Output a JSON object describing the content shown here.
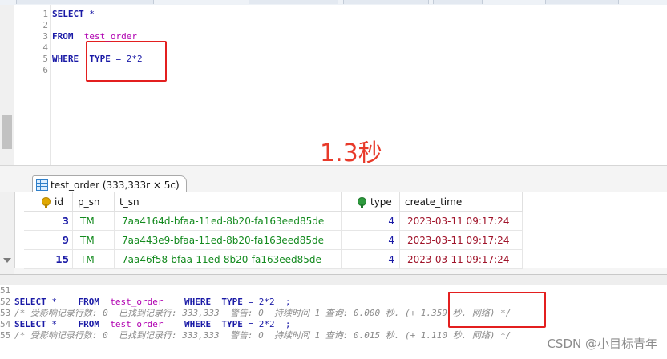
{
  "editor": {
    "lines": [
      {
        "n": "1",
        "parts": [
          [
            "kw",
            "SELECT"
          ],
          [
            "op",
            " *"
          ]
        ]
      },
      {
        "n": "2",
        "parts": []
      },
      {
        "n": "3",
        "parts": [
          [
            "kw",
            "FROM"
          ],
          [
            "op",
            "  "
          ],
          [
            "tbl",
            "test_order"
          ]
        ]
      },
      {
        "n": "4",
        "parts": []
      },
      {
        "n": "5",
        "parts": [
          [
            "kw",
            "WHERE"
          ],
          [
            "op",
            "  "
          ],
          [
            "kw",
            "TYPE"
          ],
          [
            "op",
            " = "
          ],
          [
            "num",
            "2*2"
          ]
        ]
      },
      {
        "n": "6",
        "parts": []
      }
    ],
    "timing_note": "1.3秒"
  },
  "result_tab": {
    "label": "test_order (333,333r × 5c)"
  },
  "grid": {
    "columns": [
      "id",
      "p_sn",
      "t_sn",
      "type",
      "create_time"
    ],
    "rows": [
      [
        "3",
        "TM",
        "7aa4164d-bfaa-11ed-8b20-fa163eed85de",
        "4",
        "2023-03-11 09:17:24"
      ],
      [
        "9",
        "TM",
        "7aa443e9-bfaa-11ed-8b20-fa163eed85de",
        "4",
        "2023-03-11 09:17:24"
      ],
      [
        "15",
        "TM",
        "7aa46f58-bfaa-11ed-8b20-fa163eed85de",
        "4",
        "2023-03-11 09:17:24"
      ]
    ]
  },
  "messages": [
    {
      "n": "51",
      "parts": []
    },
    {
      "n": "52",
      "parts": [
        [
          "kw",
          "SELECT"
        ],
        [
          "op",
          " *    "
        ],
        [
          "kw",
          "FROM"
        ],
        [
          "op",
          "  "
        ],
        [
          "tbl",
          "test_order"
        ],
        [
          "op",
          "    "
        ],
        [
          "kw",
          "WHERE"
        ],
        [
          "op",
          "  "
        ],
        [
          "kw",
          "TYPE"
        ],
        [
          "op",
          " = "
        ],
        [
          "num",
          "2*2"
        ],
        [
          "op",
          "  ;"
        ]
      ]
    },
    {
      "n": "53",
      "parts": [
        [
          "cmt",
          "/* 受影响记录行数: 0  已找到记录行: 333,333  警告: 0  持续时间 1 查询: 0.000 秒. (+ 1.359 秒. 网络) */"
        ]
      ]
    },
    {
      "n": "54",
      "parts": [
        [
          "kw",
          "SELECT"
        ],
        [
          "op",
          " *    "
        ],
        [
          "kw",
          "FROM"
        ],
        [
          "op",
          "  "
        ],
        [
          "tbl",
          "test_order"
        ],
        [
          "op",
          "    "
        ],
        [
          "kw",
          "WHERE"
        ],
        [
          "op",
          "  "
        ],
        [
          "kw",
          "TYPE"
        ],
        [
          "op",
          " = "
        ],
        [
          "num",
          "2*2"
        ],
        [
          "op",
          "  ;"
        ]
      ]
    },
    {
      "n": "55",
      "parts": [
        [
          "cmt",
          "/* 受影响记录行数: 0  已找到记录行: 333,333  警告: 0  持续时间 1 查询: 0.015 秒. (+ 1.110 秒. 网络) */"
        ]
      ]
    }
  ],
  "watermark": "CSDN @小目标青年",
  "colors": {
    "highlight": "#e31f1f",
    "keyword": "#1a1aa6",
    "table": "#b000b0"
  }
}
